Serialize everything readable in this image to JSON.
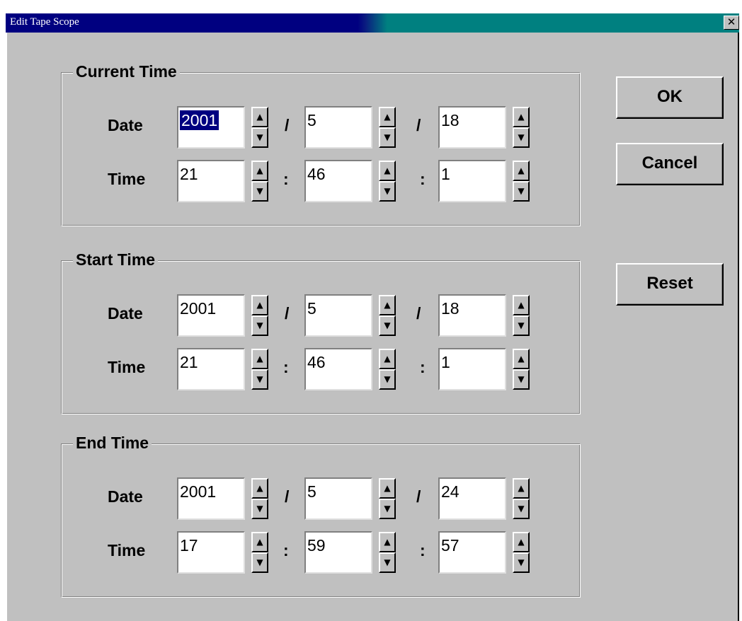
{
  "window": {
    "title": "Edit Tape Scope",
    "close_glyph": "✕"
  },
  "icons": {
    "up": "▲",
    "down": "▼"
  },
  "groups": [
    {
      "title": "Current Time",
      "date_label": "Date",
      "time_label": "Time",
      "date": [
        "2001",
        "5",
        "18"
      ],
      "time": [
        "21",
        "46",
        "1"
      ],
      "date_sep": "/",
      "time_sep": ":"
    },
    {
      "title": "Start Time",
      "date_label": "Date",
      "time_label": "Time",
      "date": [
        "2001",
        "5",
        "18"
      ],
      "time": [
        "21",
        "46",
        "1"
      ],
      "date_sep": "/",
      "time_sep": ":"
    },
    {
      "title": "End Time",
      "date_label": "Date",
      "time_label": "Time",
      "date": [
        "2001",
        "5",
        "24"
      ],
      "time": [
        "17",
        "59",
        "57"
      ],
      "date_sep": "/",
      "time_sep": ":"
    }
  ],
  "buttons": {
    "ok": "OK",
    "cancel": "Cancel",
    "reset": "Reset"
  }
}
